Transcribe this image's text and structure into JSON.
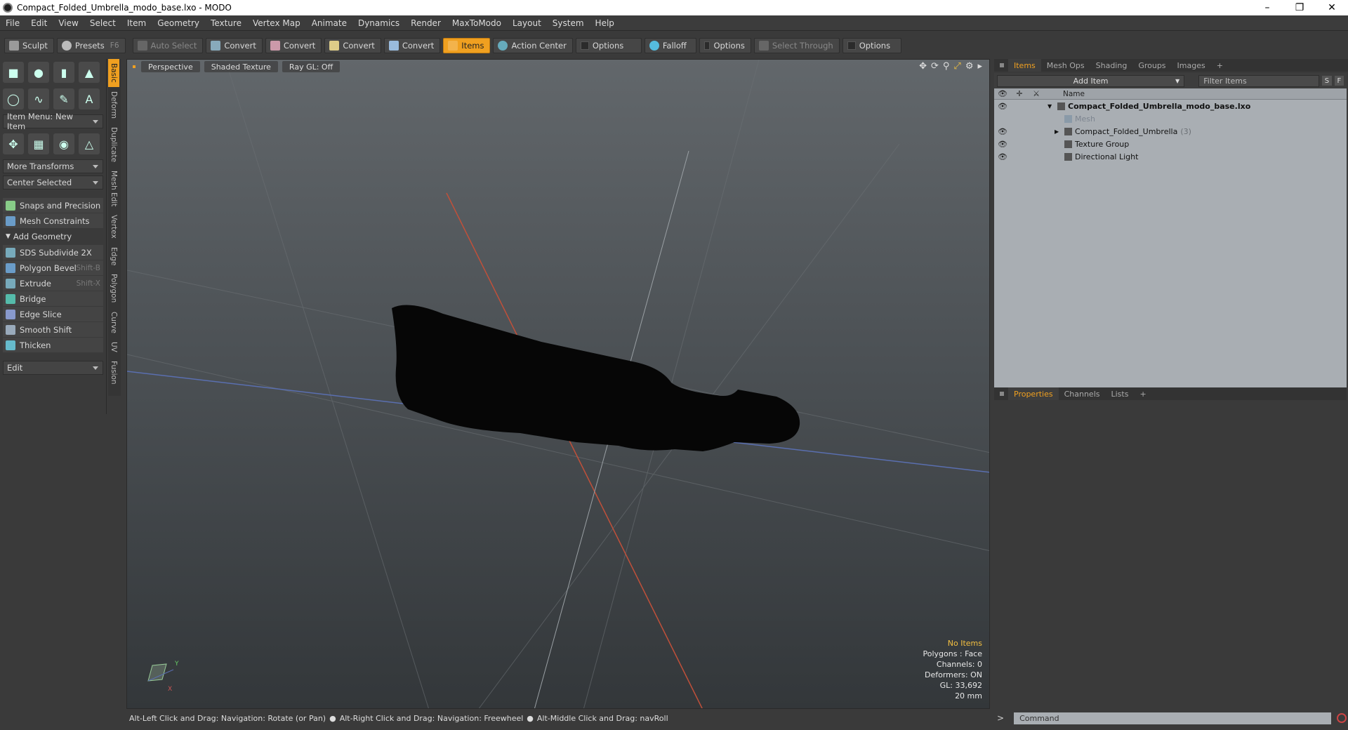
{
  "window": {
    "title": "Compact_Folded_Umbrella_modo_base.lxo - MODO"
  },
  "menu": [
    "File",
    "Edit",
    "View",
    "Select",
    "Item",
    "Geometry",
    "Texture",
    "Vertex Map",
    "Animate",
    "Dynamics",
    "Render",
    "MaxToModo",
    "Layout",
    "System",
    "Help"
  ],
  "toolbar": {
    "sculpt": "Sculpt",
    "presets": "Presets",
    "presets_hint": "F6",
    "auto_select": "Auto Select",
    "convert1": "Convert",
    "convert2": "Convert",
    "convert3": "Convert",
    "convert4": "Convert",
    "items": "Items",
    "action_center": "Action Center",
    "options1": "Options",
    "falloff": "Falloff",
    "options2": "Options",
    "select_through": "Select Through",
    "options3": "Options"
  },
  "left": {
    "item_menu": "Item Menu: New Item",
    "more_transforms": "More Transforms",
    "center_selected": "Center Selected",
    "snaps": "Snaps and Precision",
    "mesh_constraints": "Mesh Constraints",
    "add_geometry": "Add Geometry",
    "tools": [
      {
        "label": "SDS Subdivide 2X",
        "shortcut": ""
      },
      {
        "label": "Polygon Bevel",
        "shortcut": "Shift-B"
      },
      {
        "label": "Extrude",
        "shortcut": "Shift-X"
      },
      {
        "label": "Bridge",
        "shortcut": ""
      },
      {
        "label": "Edge Slice",
        "shortcut": ""
      },
      {
        "label": "Smooth Shift",
        "shortcut": ""
      },
      {
        "label": "Thicken",
        "shortcut": ""
      }
    ],
    "edit": "Edit"
  },
  "sidetabs": [
    "Basic",
    "Deform",
    "Duplicate",
    "Mesh Edit",
    "Vertex",
    "Edge",
    "Polygon",
    "Curve",
    "UV",
    "Fusion"
  ],
  "viewport": {
    "tabs": [
      "Perspective",
      "Shaded Texture",
      "Ray GL: Off"
    ],
    "info": {
      "no_items": "No Items",
      "polygons": "Polygons : Face",
      "channels": "Channels: 0",
      "deformers": "Deformers: ON",
      "gl": "GL: 33,692",
      "scale": "20 mm"
    }
  },
  "status": {
    "hint1": "Alt-Left Click and Drag: Navigation: Rotate (or Pan)",
    "hint2": "Alt-Right Click and Drag: Navigation: Freewheel",
    "hint3": "Alt-Middle Click and Drag: navRoll"
  },
  "right": {
    "tabs": [
      "Items",
      "Mesh Ops",
      "Shading",
      "Groups",
      "Images"
    ],
    "add_item": "Add Item",
    "filter": "Filter Items",
    "s": "S",
    "f": "F",
    "name_col": "Name",
    "tree": [
      {
        "label": "Compact_Folded_Umbrella_modo_base.lxo",
        "level": 0
      },
      {
        "label": "Mesh",
        "level": 1
      },
      {
        "label": "Compact_Folded_Umbrella",
        "count": "(3)",
        "level": 1
      },
      {
        "label": "Texture Group",
        "level": 1
      },
      {
        "label": "Directional Light",
        "level": 1
      }
    ],
    "props_tabs": [
      "Properties",
      "Channels",
      "Lists"
    ],
    "command": "Command"
  }
}
